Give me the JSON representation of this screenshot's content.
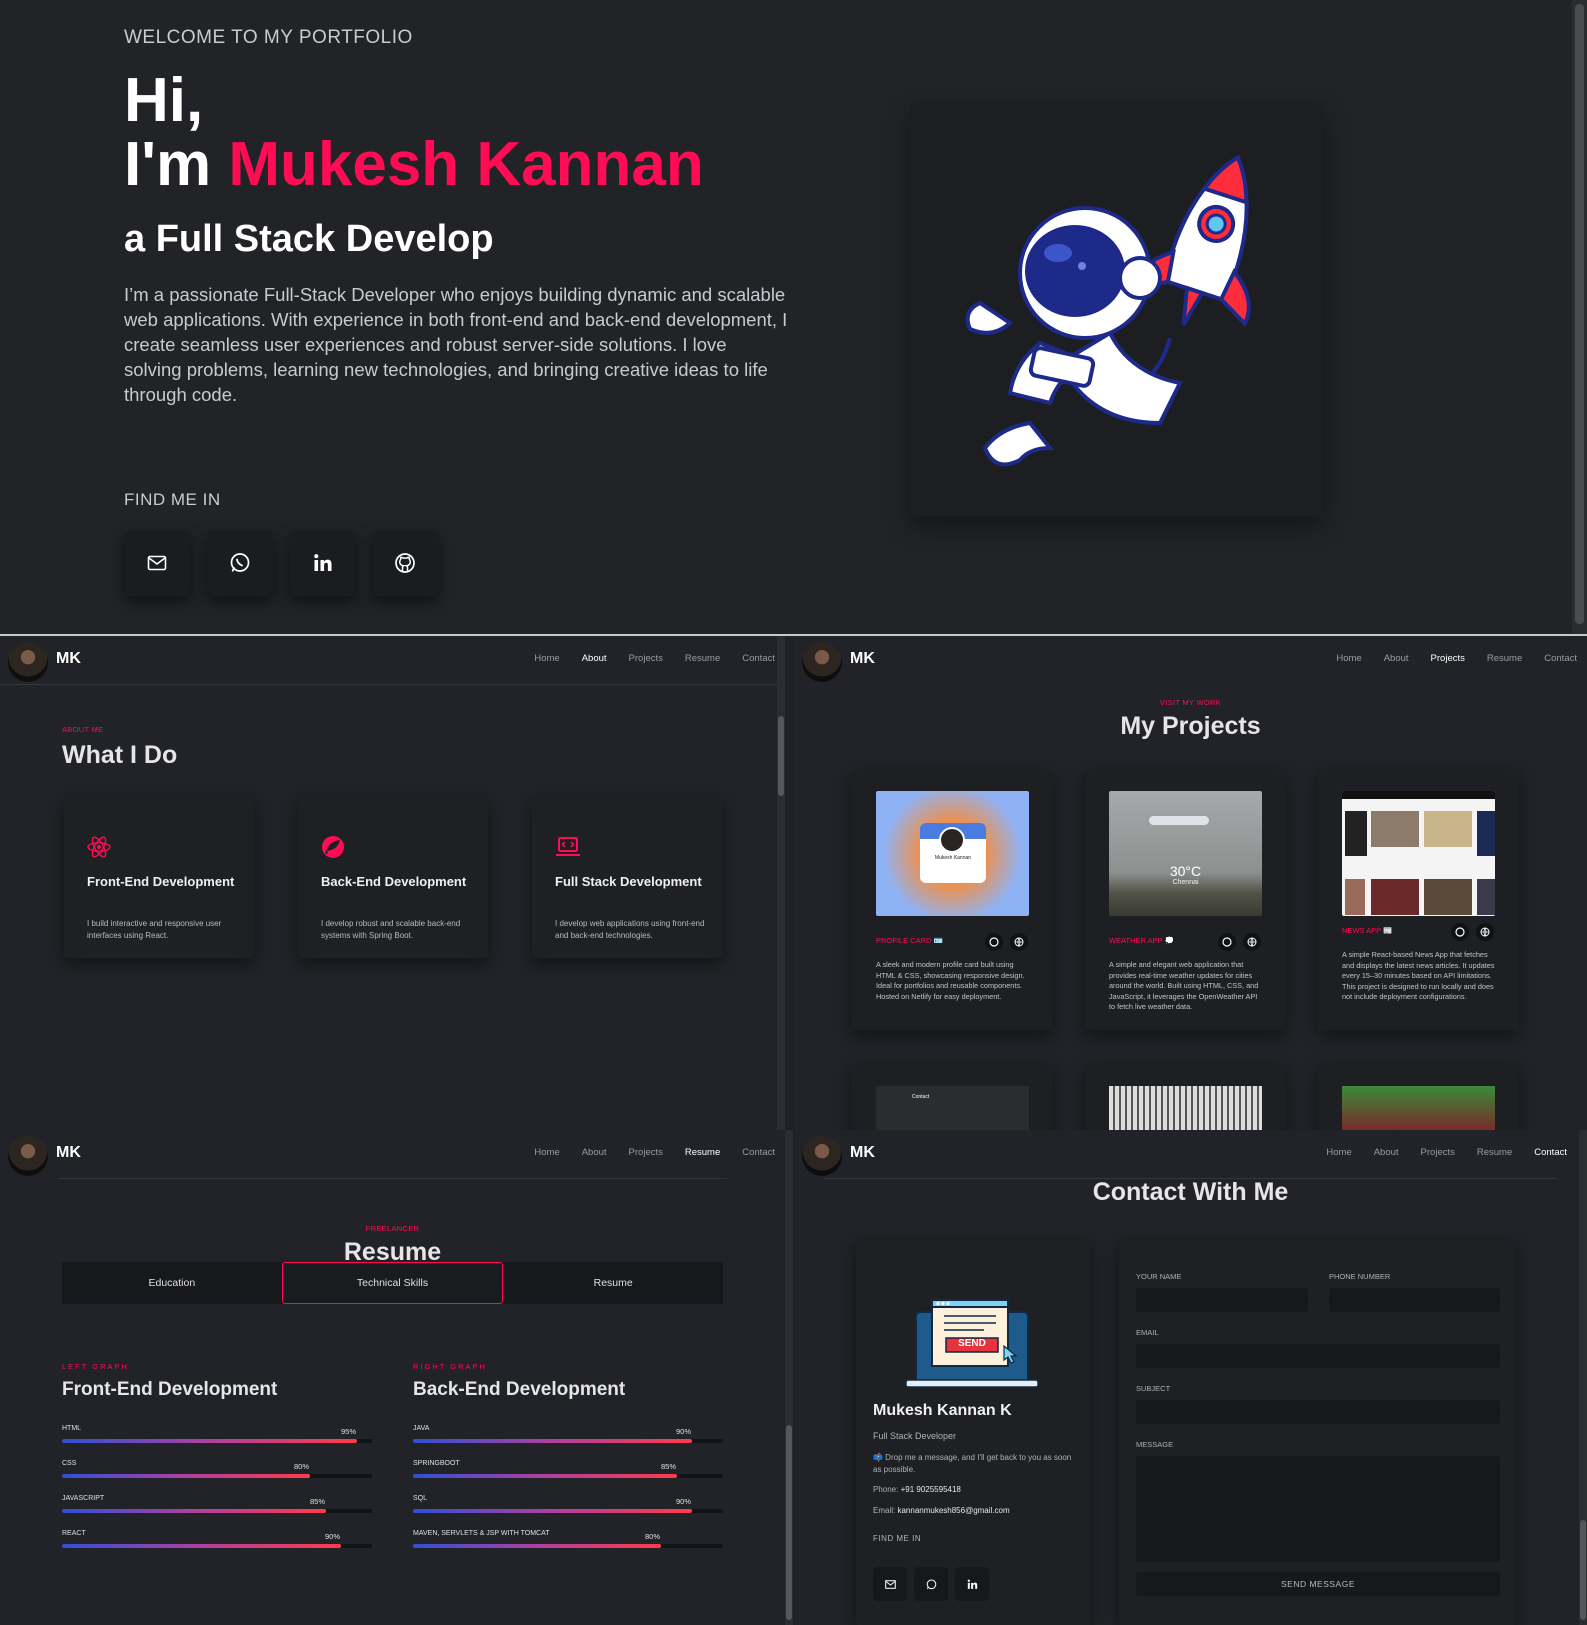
{
  "hero": {
    "welcome": "WELCOME TO MY PORTFOLIO",
    "hi": "Hi,",
    "im": "I'm",
    "name": "Mukesh Kannan",
    "role": "a Full Stack Develop",
    "bio": "I’m a passionate Full-Stack Developer who enjoys building dynamic and scalable web applications. With experience in both front-end and back-end development, I create seamless user experiences and robust server-side solutions. I love solving problems, learning new technologies, and bringing creative ideas to life through code.",
    "find_me": "FIND ME IN",
    "socials": [
      "mail-icon",
      "whatsapp-icon",
      "linkedin-icon",
      "github-icon"
    ],
    "accent": "#ff0c55"
  },
  "nav": {
    "logo": "MK",
    "links": [
      "Home",
      "About",
      "Projects",
      "Resume",
      "Contact"
    ]
  },
  "about": {
    "eyebrow": "ABOUT ME",
    "title": "What I Do",
    "cards": [
      {
        "title": "Front-End Development",
        "text": "I build interactive and responsive user interfaces using React.",
        "icon": "react-icon"
      },
      {
        "title": "Back-End Development",
        "text": "I develop robust and scalable back-end systems with Spring Boot.",
        "icon": "spring-icon"
      },
      {
        "title": "Full Stack Development",
        "text": "I develop web applications using front-end and back-end technologies.",
        "icon": "laptop-code-icon"
      }
    ]
  },
  "projects": {
    "eyebrow": "VISIT MY WORK",
    "title": "My Projects",
    "items": [
      {
        "name": "PROFILE CARD 🪪",
        "desc": "A sleek and modern profile card built using HTML & CSS, showcasing responsive design. Ideal for portfolios and reusable components. Hosted on Netlify for easy deployment.",
        "thumb_name": "Mukesh Kannan"
      },
      {
        "name": "WEATHER APP 💭",
        "desc": "A simple and elegant web application that provides real-time weather updates for cities around the world. Built using HTML, CSS, and JavaScript, it leverages the OpenWeather API to fetch live weather data.",
        "thumb_temp": "30°C",
        "thumb_city": "Chennai"
      },
      {
        "name": "NEWS APP 📰",
        "desc": "A simple React-based News App that fetches and displays the latest news articles. It updates every 15–30 minutes based on API limitations. This project is designed to run locally and does not include deployment configurations."
      }
    ],
    "row2_thumb_label": "Contact"
  },
  "resume": {
    "eyebrow": "FREELANCER",
    "title": "Resume",
    "tabs": [
      "Education",
      "Technical Skills",
      "Resume"
    ],
    "left": {
      "eyebrow": "LEFT GRAPH",
      "title": "Front-End Development",
      "skills": [
        {
          "name": "HTML",
          "pct_label": "95%",
          "pct": 95
        },
        {
          "name": "CSS",
          "pct_label": "80%",
          "pct": 80
        },
        {
          "name": "JAVASCRIPT",
          "pct_label": "85%",
          "pct": 85
        },
        {
          "name": "REACT",
          "pct_label": "90%",
          "pct": 90
        }
      ]
    },
    "right": {
      "eyebrow": "RIGHT GRAPH",
      "title": "Back-End Development",
      "skills": [
        {
          "name": "JAVA",
          "pct_label": "90%",
          "pct": 90
        },
        {
          "name": "SPRINGBOOT",
          "pct_label": "85%",
          "pct": 85
        },
        {
          "name": "SQL",
          "pct_label": "90%",
          "pct": 90
        },
        {
          "name": "MAVEN, SERVLETS & JSP WITH TOMCAT",
          "pct_label": "80%",
          "pct": 80
        }
      ]
    }
  },
  "contact": {
    "title": "Contact With Me",
    "name": "Mukesh Kannan K",
    "role": "Full Stack Developer",
    "message": "📫 Drop me a message, and I'll get back to you as soon as possible.",
    "phone_label": "Phone:",
    "phone": "+91 9025595418",
    "email_label": "Email:",
    "email": "kannanmukesh856@gmail.com",
    "find_me": "FIND ME IN",
    "send_badge": "SEND",
    "form": {
      "your_name": "YOUR NAME",
      "phone_number": "PHONE NUMBER",
      "email": "EMAIL",
      "subject": "SUBJECT",
      "message": "MESSAGE",
      "submit": "SEND MESSAGE"
    }
  }
}
